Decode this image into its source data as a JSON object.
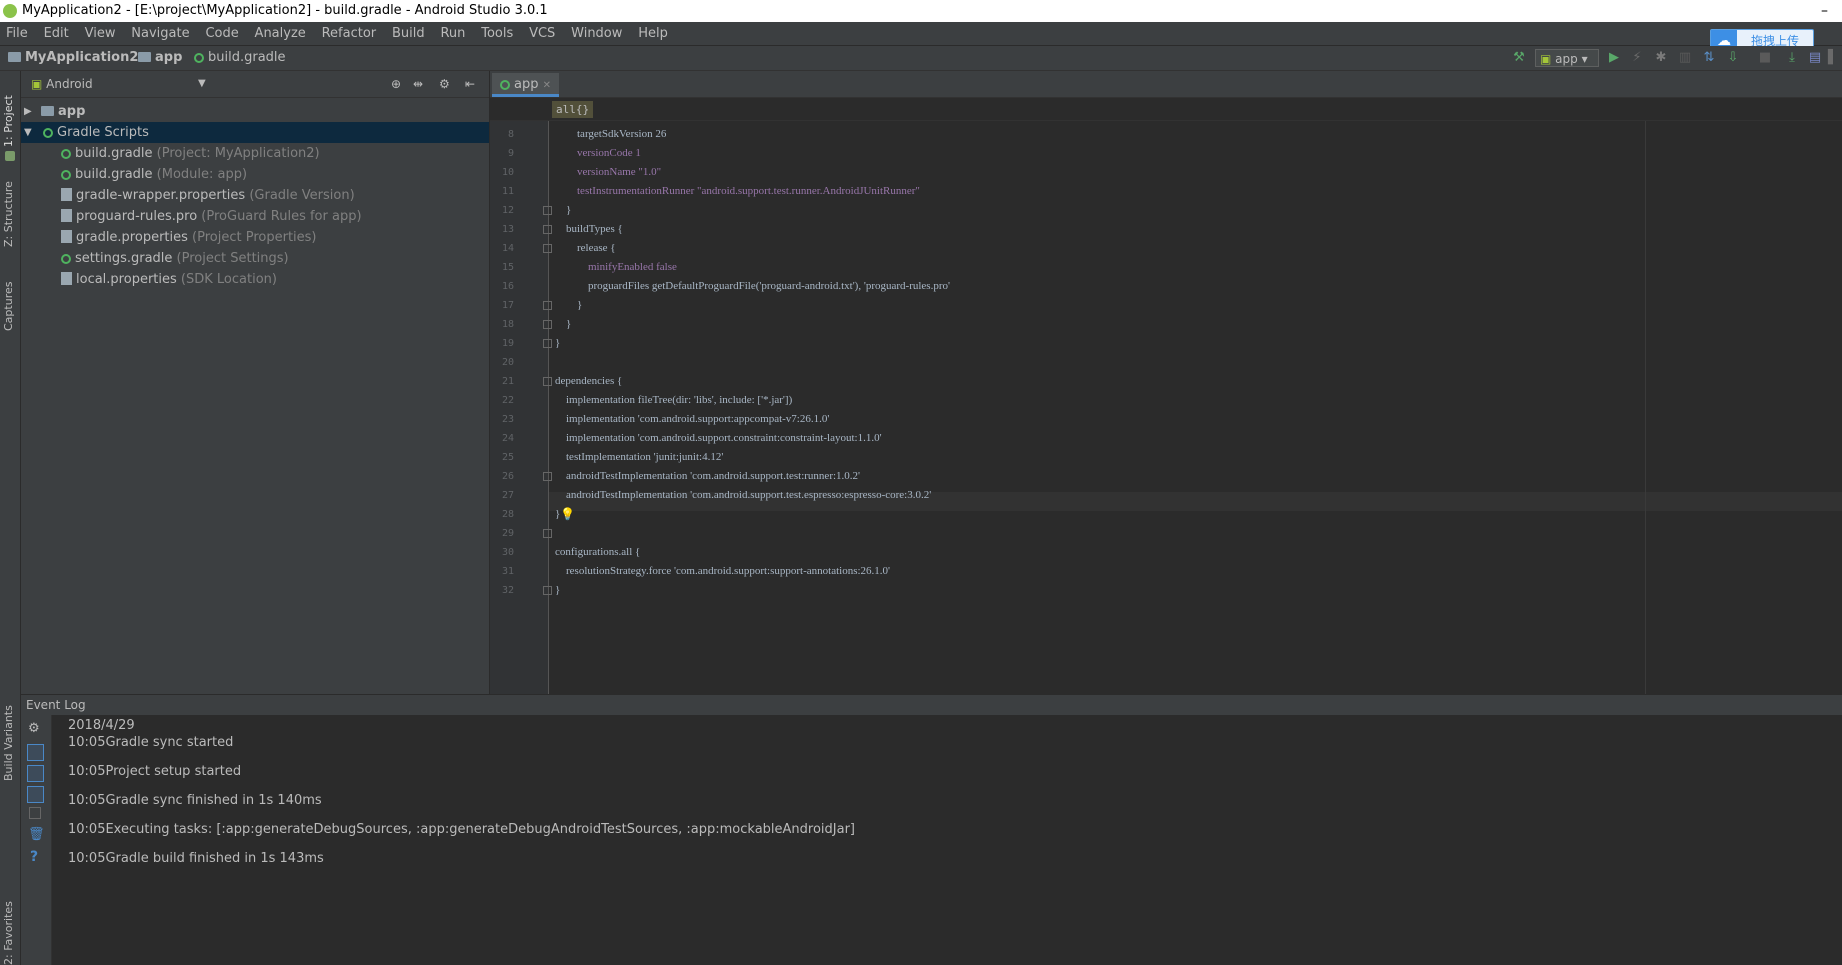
{
  "window": {
    "title": "MyApplication2 - [E:\\project\\MyApplication2] - build.gradle - Android Studio 3.0.1",
    "minimize": "–"
  },
  "menu": [
    "File",
    "Edit",
    "View",
    "Navigate",
    "Code",
    "Analyze",
    "Refactor",
    "Build",
    "Run",
    "Tools",
    "VCS",
    "Window",
    "Help"
  ],
  "cloud_widget": {
    "label": "拖拽上传"
  },
  "breadcrumb": {
    "project": "MyApplication2",
    "module": "app",
    "file": "build.gradle"
  },
  "run_config": {
    "label": "app"
  },
  "side_tabs": {
    "project": "1: Project",
    "structure": "Z: Structure",
    "captures": "Captures",
    "build_variants": "Build Variants",
    "favorites": "2: Favorites"
  },
  "project_panel": {
    "view_mode": "Android",
    "tree": {
      "app": {
        "label": "app"
      },
      "gradle_scripts": {
        "label": "Gradle Scripts"
      },
      "children": [
        {
          "name": "build.gradle",
          "hint": "(Project: MyApplication2)",
          "icon": "gradle-icon"
        },
        {
          "name": "build.gradle",
          "hint": "(Module: app)",
          "icon": "gradle-icon"
        },
        {
          "name": "gradle-wrapper.properties",
          "hint": "(Gradle Version)",
          "icon": "properties-icon"
        },
        {
          "name": "proguard-rules.pro",
          "hint": "(ProGuard Rules for app)",
          "icon": "properties-icon"
        },
        {
          "name": "gradle.properties",
          "hint": "(Project Properties)",
          "icon": "properties-icon"
        },
        {
          "name": "settings.gradle",
          "hint": "(Project Settings)",
          "icon": "gradle-icon"
        },
        {
          "name": "local.properties",
          "hint": "(SDK Location)",
          "icon": "properties-icon"
        }
      ]
    }
  },
  "editor": {
    "tab": {
      "label": "app"
    },
    "crumb": "all{}",
    "lines": [
      {
        "n": "8",
        "code": "        targetSdkVersion 26"
      },
      {
        "n": "9",
        "code": "        versionCode 1"
      },
      {
        "n": "10",
        "code": "        versionName \"1.0\""
      },
      {
        "n": "11",
        "code": "        testInstrumentationRunner \"android.support.test.runner.AndroidJUnitRunner\""
      },
      {
        "n": "12",
        "code": "    }"
      },
      {
        "n": "13",
        "code": "    buildTypes {"
      },
      {
        "n": "14",
        "code": "        release {"
      },
      {
        "n": "15",
        "code": "            minifyEnabled false"
      },
      {
        "n": "16",
        "code": "            proguardFiles getDefaultProguardFile('proguard-android.txt'), 'proguard-rules.pro'"
      },
      {
        "n": "17",
        "code": "        }"
      },
      {
        "n": "18",
        "code": "    }"
      },
      {
        "n": "19",
        "code": "}"
      },
      {
        "n": "20",
        "code": ""
      },
      {
        "n": "21",
        "code": "dependencies {"
      },
      {
        "n": "22",
        "code": "    implementation fileTree(dir: 'libs', include: ['*.jar'])"
      },
      {
        "n": "23",
        "code": "    implementation 'com.android.support:appcompat-v7:26.1.0'"
      },
      {
        "n": "24",
        "code": "    implementation 'com.android.support.constraint:constraint-layout:1.1.0'"
      },
      {
        "n": "25",
        "code": "    testImplementation 'junit:junit:4.12'"
      },
      {
        "n": "26",
        "code": "    androidTestImplementation 'com.android.support.test:runner:1.0.2'"
      },
      {
        "n": "27",
        "code": "    androidTestImplementation 'com.android.support.test.espresso:espresso-core:3.0.2'"
      },
      {
        "n": "28",
        "code": "}"
      },
      {
        "n": "29",
        "code": ""
      },
      {
        "n": "30",
        "code": "configurations.all {"
      },
      {
        "n": "31",
        "code": "    resolutionStrategy.force 'com.android.support:support-annotations:26.1.0'"
      },
      {
        "n": "32",
        "code": "}"
      }
    ]
  },
  "event_log": {
    "title": "Event Log",
    "date": "2018/4/29",
    "entries": [
      {
        "time": "10:05",
        "text": "Gradle sync started"
      },
      {
        "time": "10:05",
        "text": "Project setup started"
      },
      {
        "time": "10:05",
        "text": "Gradle sync finished in 1s 140ms"
      },
      {
        "time": "10:05",
        "text": "Executing tasks: [:app:generateDebugSources, :app:generateDebugAndroidTestSources, :app:mockableAndroidJar]"
      },
      {
        "time": "10:05",
        "text": "Gradle build finished in 1s 143ms"
      }
    ]
  },
  "colors": {
    "accent": "#4a88c7",
    "selection": "#0d293e",
    "gradle": "#4fb35f",
    "run": "#59a869"
  }
}
